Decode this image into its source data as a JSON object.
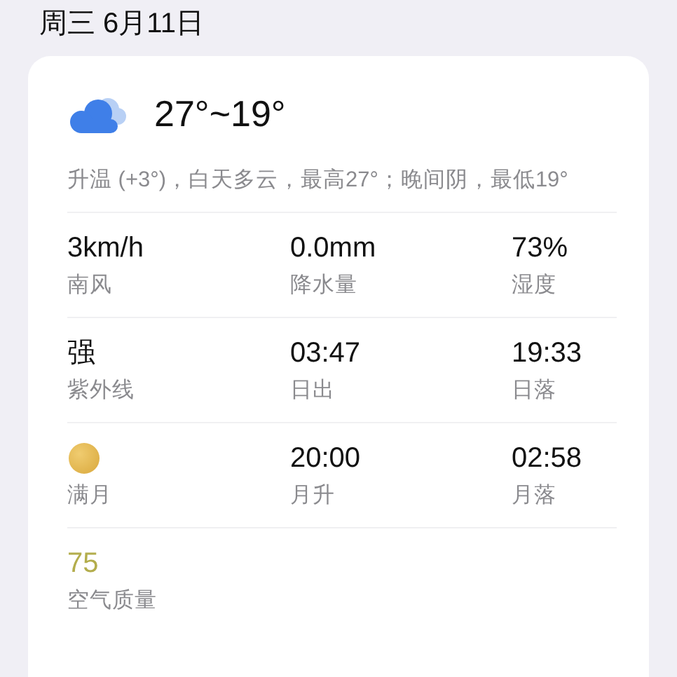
{
  "date": "周三 6月11日",
  "summary": {
    "temperature": "27°~19°",
    "description": "升温 (+3°)，白天多云，最高27°；晚间阴，最低19°"
  },
  "rows": [
    [
      {
        "kind": "text",
        "value": "3km/h",
        "label": "南风"
      },
      {
        "kind": "text",
        "value": "0.0mm",
        "label": "降水量"
      },
      {
        "kind": "text",
        "value": "73%",
        "label": "湿度"
      }
    ],
    [
      {
        "kind": "text",
        "value": "强",
        "label": "紫外线"
      },
      {
        "kind": "text",
        "value": "03:47",
        "label": "日出"
      },
      {
        "kind": "text",
        "value": "19:33",
        "label": "日落"
      }
    ],
    [
      {
        "kind": "moon",
        "label": "满月"
      },
      {
        "kind": "text",
        "value": "20:00",
        "label": "月升"
      },
      {
        "kind": "text",
        "value": "02:58",
        "label": "月落"
      }
    ],
    [
      {
        "kind": "text",
        "value": "75",
        "label": "空气质量",
        "color": "#b3ad4c"
      }
    ]
  ]
}
